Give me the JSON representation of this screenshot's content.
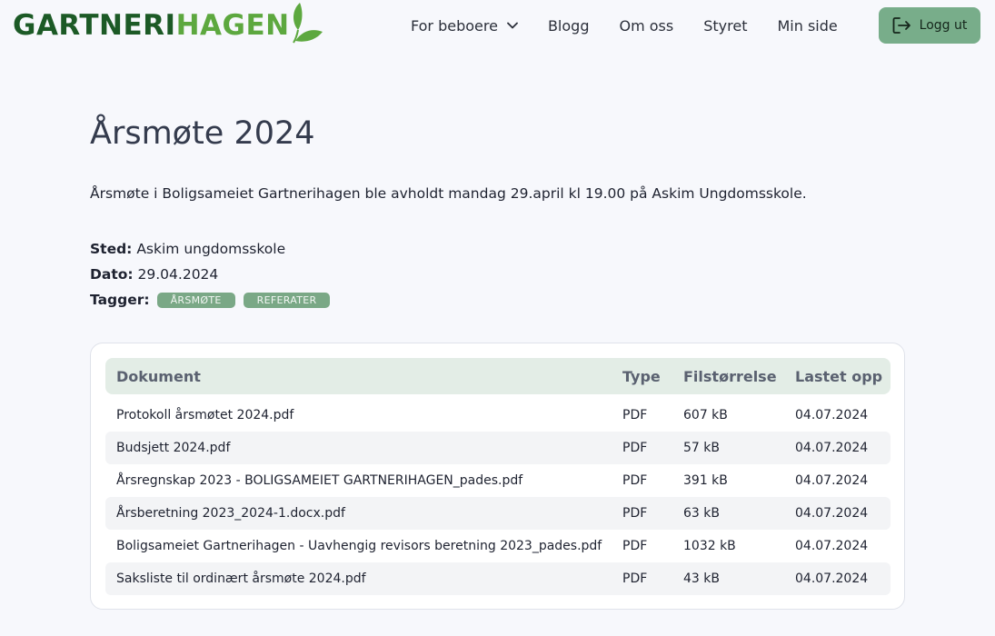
{
  "logo": {
    "part1": "GARTNERI",
    "part2": "HAGEN"
  },
  "nav": {
    "items": [
      {
        "label": "For beboere",
        "dropdown": true
      },
      {
        "label": "Blogg"
      },
      {
        "label": "Om oss"
      },
      {
        "label": "Styret"
      },
      {
        "label": "Min side"
      }
    ],
    "logout_label": "Logg ut"
  },
  "page": {
    "title": "Årsmøte 2024",
    "intro": "Årsmøte i Boligsameiet Gartnerihagen ble avholdt mandag 29.april kl 19.00 på Askim Ungdomsskole.",
    "place_label": "Sted:",
    "place": "Askim ungdomsskole",
    "date_label": "Dato:",
    "date": "29.04.2024",
    "tags_label": "Tagger:",
    "tags": [
      "ÅRSMØTE",
      "REFERATER"
    ]
  },
  "documents": {
    "columns": [
      "Dokument",
      "Type",
      "Filstørrelse",
      "Lastet opp"
    ],
    "rows": [
      {
        "name": "Protokoll årsmøtet 2024.pdf",
        "type": "PDF",
        "size": "607 kB",
        "uploaded": "04.07.2024"
      },
      {
        "name": "Budsjett 2024.pdf",
        "type": "PDF",
        "size": "57 kB",
        "uploaded": "04.07.2024"
      },
      {
        "name": "Årsregnskap 2023 - BOLIGSAMEIET GARTNERIHAGEN_pades.pdf",
        "type": "PDF",
        "size": "391 kB",
        "uploaded": "04.07.2024"
      },
      {
        "name": "Årsberetning 2023_2024-1.docx.pdf",
        "type": "PDF",
        "size": "63 kB",
        "uploaded": "04.07.2024"
      },
      {
        "name": "Boligsameiet Gartnerihagen - Uavhengig revisors beretning 2023_pades.pdf",
        "type": "PDF",
        "size": "1032 kB",
        "uploaded": "04.07.2024"
      },
      {
        "name": "Saksliste til ordinært årsmøte 2024.pdf",
        "type": "PDF",
        "size": "43 kB",
        "uploaded": "04.07.2024"
      }
    ]
  },
  "colors": {
    "brand_dark": "#1c5a26",
    "brand_light": "#5da83f",
    "accent": "#78ad8a",
    "table_header_bg": "#e3ede6"
  },
  "icons": {
    "logo": "leaf-icon",
    "dropdown": "chevron-down-icon",
    "logout": "logout-icon"
  }
}
